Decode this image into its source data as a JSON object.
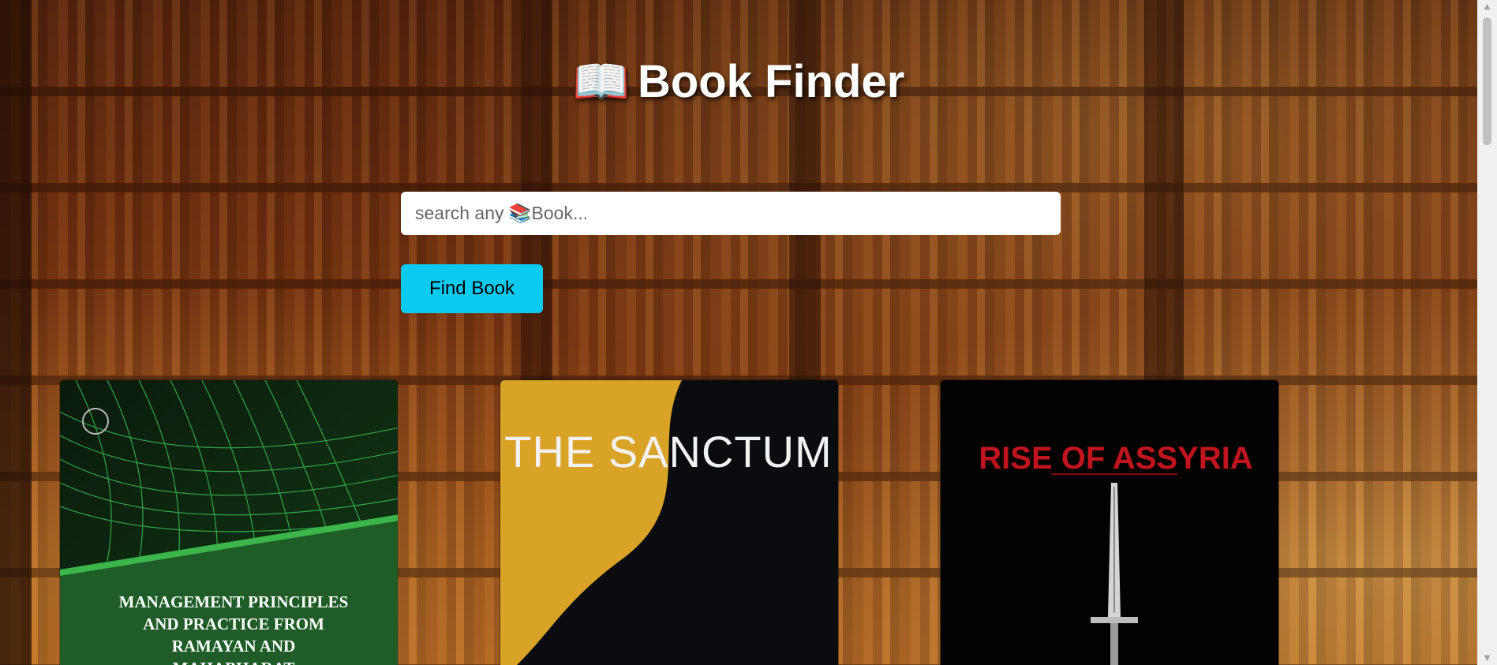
{
  "header": {
    "icon": "open-book-icon",
    "icon_glyph": "📖",
    "title": "Book Finder"
  },
  "search": {
    "placeholder": "search any 📚Book..."
  },
  "button": {
    "label": "Find Book"
  },
  "books": [
    {
      "cover_lines": [
        "MANAGEMENT PRINCIPLES",
        "AND PRACTICE FROM",
        "RAMAYAN AND",
        "MAHABHARAT"
      ]
    },
    {
      "cover_title": "THE SANCTUM"
    },
    {
      "cover_title": "RISE OF ASSYRIA"
    }
  ],
  "colors": {
    "button_bg": "#0dcaf0",
    "title_text": "#ffffff"
  }
}
